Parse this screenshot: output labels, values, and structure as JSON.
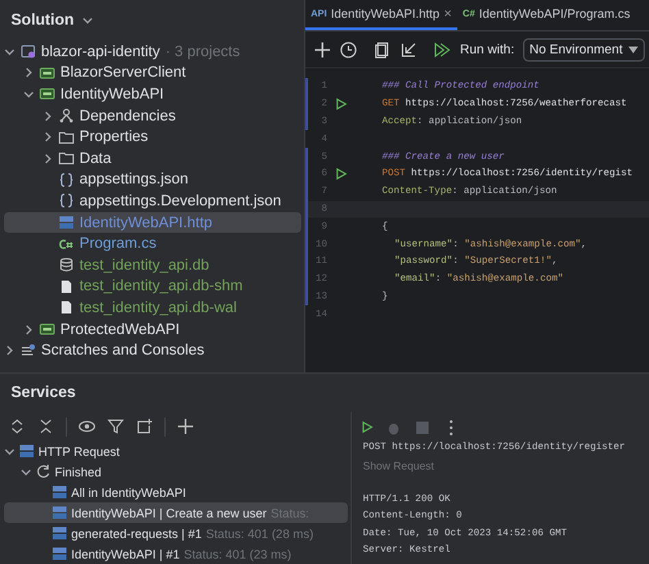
{
  "solution": {
    "title": "Solution",
    "tree": [
      {
        "label": "blazor-api-identity",
        "suffix": "· 3 projects",
        "kind": "solution",
        "expanded": true,
        "selected": false,
        "color": "#dfe1e5",
        "children": [
          {
            "label": "BlazorServerClient",
            "kind": "project",
            "expanded": false,
            "selected": false,
            "color": "#dfe1e5"
          },
          {
            "label": "IdentityWebAPI",
            "kind": "project",
            "expanded": true,
            "selected": false,
            "color": "#dfe1e5",
            "children": [
              {
                "label": "Dependencies",
                "kind": "deps",
                "expanded": false,
                "selected": false,
                "color": "#dfe1e5"
              },
              {
                "label": "Properties",
                "kind": "folder",
                "expanded": false,
                "selected": false,
                "color": "#dfe1e5"
              },
              {
                "label": "Data",
                "kind": "folder",
                "expanded": false,
                "selected": false,
                "color": "#dfe1e5"
              },
              {
                "label": "appsettings.json",
                "kind": "json",
                "selected": false,
                "color": "#dfe1e5"
              },
              {
                "label": "appsettings.Development.json",
                "kind": "json",
                "selected": false,
                "color": "#dfe1e5"
              },
              {
                "label": "IdentityWebAPI.http",
                "kind": "http",
                "selected": true,
                "color": "#6f8fd8"
              },
              {
                "label": "Program.cs",
                "kind": "cs",
                "selected": false,
                "color": "#6f9ed8"
              },
              {
                "label": "test_identity_api.db",
                "kind": "db",
                "selected": false,
                "color": "#73a35a"
              },
              {
                "label": "test_identity_api.db-shm",
                "kind": "file",
                "selected": false,
                "color": "#73a35a"
              },
              {
                "label": "test_identity_api.db-wal",
                "kind": "file",
                "selected": false,
                "color": "#73a35a"
              }
            ]
          },
          {
            "label": "ProtectedWebAPI",
            "kind": "project",
            "expanded": false,
            "selected": false,
            "color": "#dfe1e5"
          }
        ]
      },
      {
        "label": "Scratches and Consoles",
        "kind": "scratch",
        "expanded": false,
        "selected": false,
        "color": "#dfe1e5"
      }
    ]
  },
  "editor": {
    "tabs": [
      {
        "badge": "API",
        "label": "IdentityWebAPI.http",
        "close": "×",
        "selected": true
      },
      {
        "badge": "C#",
        "label": "IdentityWebAPI/Program.cs",
        "selected": false
      }
    ],
    "run_with_label": "Run with:",
    "environment": "No Environment",
    "lines": [
      {
        "number": "1",
        "run": false,
        "block": true,
        "current": false,
        "tokens": [
          {
            "kind": "comment",
            "text": "### Call Protected endpoint"
          }
        ]
      },
      {
        "number": "2",
        "run": true,
        "block": true,
        "current": false,
        "tokens": [
          {
            "kind": "method",
            "text": "GET "
          },
          {
            "kind": "url",
            "text": "https://localhost:7256/weatherforecast"
          }
        ]
      },
      {
        "number": "3",
        "run": false,
        "block": true,
        "current": false,
        "tokens": [
          {
            "kind": "header",
            "text": "Accept"
          },
          {
            "kind": "plain",
            "text": ": application/json"
          }
        ]
      },
      {
        "number": "4",
        "run": false,
        "block": false,
        "current": false
      },
      {
        "number": "5",
        "run": false,
        "block": true,
        "current": false,
        "tokens": [
          {
            "kind": "comment",
            "text": "### Create a new user"
          }
        ]
      },
      {
        "number": "6",
        "run": true,
        "block": true,
        "current": false,
        "tokens": [
          {
            "kind": "method",
            "text": "POST "
          },
          {
            "kind": "url",
            "text": "https://localhost:7256/identity/regist"
          }
        ]
      },
      {
        "number": "7",
        "run": false,
        "block": true,
        "current": false,
        "tokens": [
          {
            "kind": "header",
            "text": "Content-Type"
          },
          {
            "kind": "plain",
            "text": ": application/json"
          }
        ]
      },
      {
        "number": "8",
        "run": false,
        "block": true,
        "current": true
      },
      {
        "number": "9",
        "run": false,
        "block": true,
        "current": false,
        "tokens": [
          {
            "kind": "plain",
            "text": "{"
          }
        ]
      },
      {
        "number": "10",
        "run": false,
        "block": true,
        "current": false,
        "indented": true,
        "tokens": [
          {
            "kind": "key",
            "text": "\"username\""
          },
          {
            "kind": "plain",
            "text": ": "
          },
          {
            "kind": "string",
            "text": "\"ashish@example.com\""
          },
          {
            "kind": "plain",
            "text": ","
          }
        ]
      },
      {
        "number": "11",
        "run": false,
        "block": true,
        "current": false,
        "indented": true,
        "tokens": [
          {
            "kind": "key",
            "text": "\"password\""
          },
          {
            "kind": "plain",
            "text": ": "
          },
          {
            "kind": "string",
            "text": "\"SuperSecret1!\""
          },
          {
            "kind": "plain",
            "text": ","
          }
        ]
      },
      {
        "number": "12",
        "run": false,
        "block": true,
        "current": false,
        "indented": true,
        "tokens": [
          {
            "kind": "key",
            "text": "\"email\""
          },
          {
            "kind": "plain",
            "text": ": "
          },
          {
            "kind": "string",
            "text": "\"ashish@example.com\""
          }
        ]
      },
      {
        "number": "13",
        "run": false,
        "block": true,
        "current": false,
        "tokens": [
          {
            "kind": "plain",
            "text": "}"
          }
        ]
      },
      {
        "number": "14",
        "run": false,
        "block": false,
        "current": false
      }
    ]
  },
  "services": {
    "title": "Services",
    "tree": [
      {
        "label": "HTTP Request",
        "kind": "http",
        "expanded": true,
        "selected": false,
        "children": [
          {
            "label": "Finished",
            "kind": "refresh",
            "expanded": true,
            "selected": false,
            "children": [
              {
                "label": "All in IdentityWebAPI",
                "kind": "http",
                "selected": false
              },
              {
                "label": "IdentityWebAPI | Create a new user",
                "status": "Status:",
                "kind": "http",
                "selected": true
              },
              {
                "label": "generated-requests | #1",
                "status": "Status: 401 (28 ms)",
                "kind": "http",
                "selected": false
              },
              {
                "label": "IdentityWebAPI | #1",
                "status": "Status: 401 (23 ms)",
                "kind": "http",
                "selected": false
              }
            ]
          }
        ]
      }
    ],
    "output": {
      "request": "POST https://localhost:7256/identity/register",
      "show_request": "Show Request",
      "response": [
        "HTTP/1.1 200 OK",
        "Content-Length: 0",
        "Date: Tue, 10 Oct 2023 14:52:06 GMT",
        "Server: Kestrel"
      ]
    }
  }
}
